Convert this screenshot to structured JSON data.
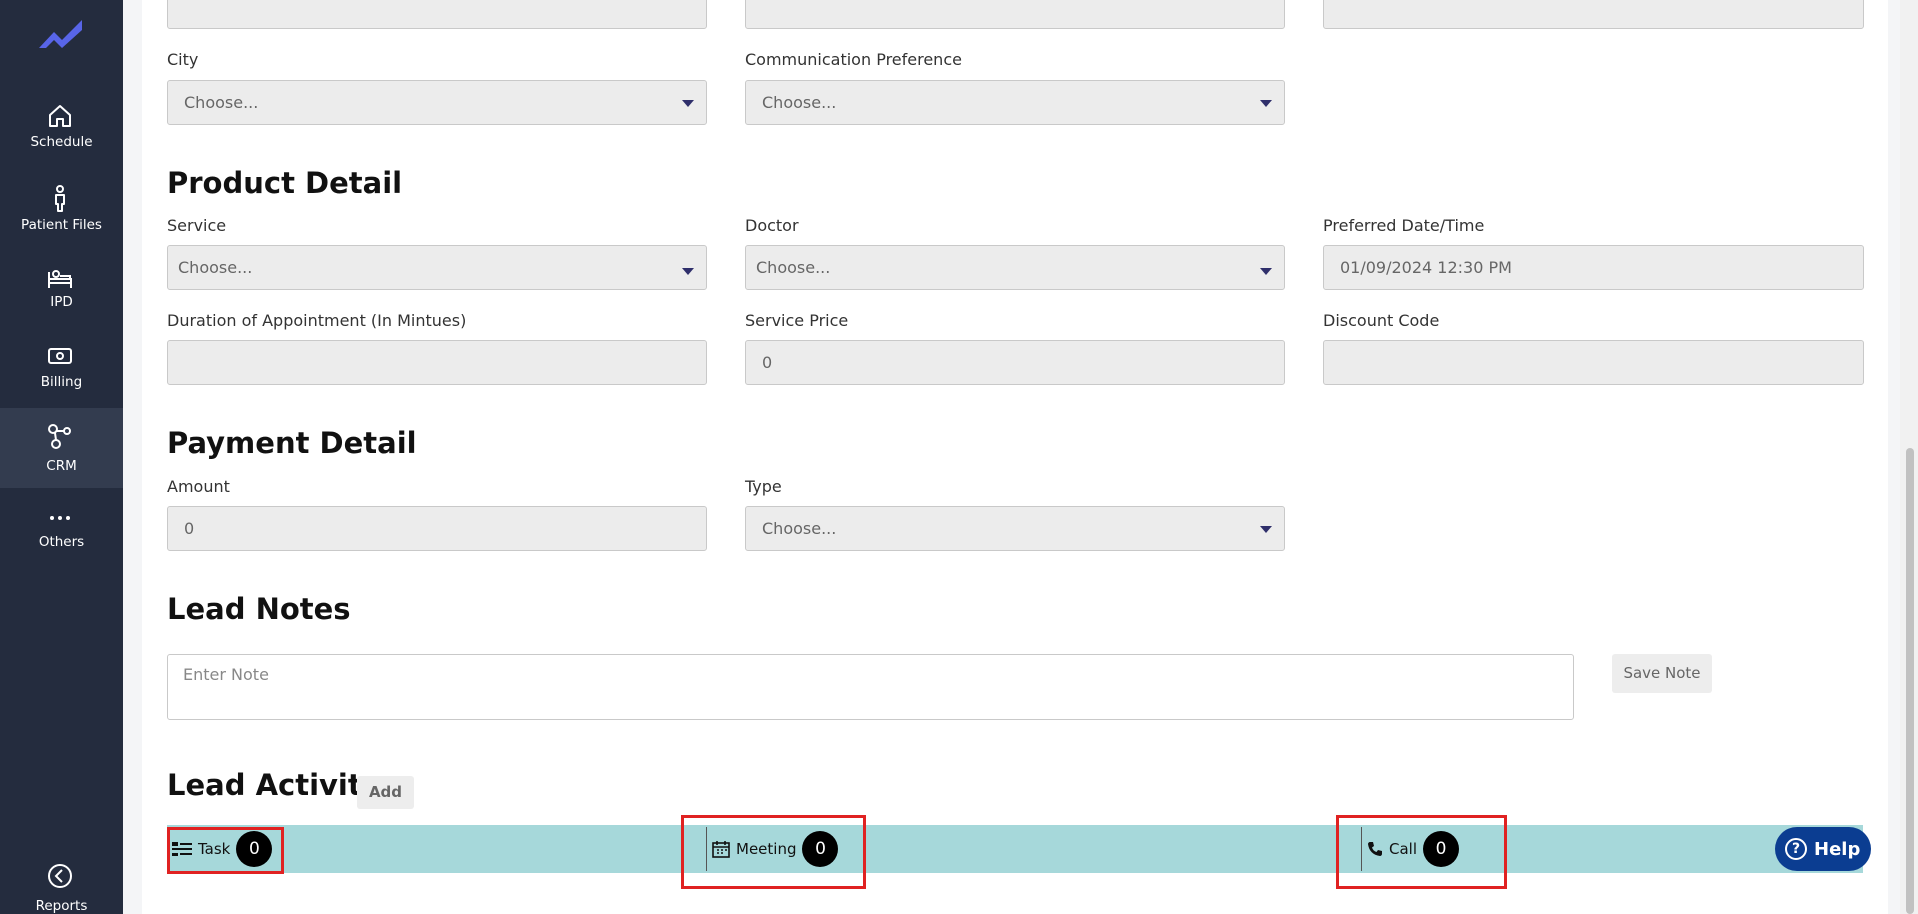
{
  "sidebar": {
    "items": [
      {
        "label": "Schedule",
        "icon": "home-icon"
      },
      {
        "label": "Patient Files",
        "icon": "person-icon"
      },
      {
        "label": "IPD",
        "icon": "bed-icon"
      },
      {
        "label": "Billing",
        "icon": "money-icon"
      },
      {
        "label": "CRM",
        "icon": "crm-icon"
      },
      {
        "label": "Others",
        "icon": "dots-icon"
      },
      {
        "label": "Reports",
        "icon": "reports-icon"
      }
    ],
    "active": "CRM"
  },
  "contact": {
    "city_label": "City",
    "city_value": "Choose...",
    "comm_label": "Communication Preference",
    "comm_value": "Choose..."
  },
  "product": {
    "title": "Product Detail",
    "service_label": "Service",
    "service_value": "Choose...",
    "doctor_label": "Doctor",
    "doctor_value": "Choose...",
    "date_label": "Preferred Date/Time",
    "date_value": "01/09/2024 12:30 PM",
    "duration_label": "Duration of Appointment (In Mintues)",
    "duration_value": "",
    "price_label": "Service Price",
    "price_value": "0",
    "discount_label": "Discount Code",
    "discount_value": ""
  },
  "payment": {
    "title": "Payment Detail",
    "amount_label": "Amount",
    "amount_value": "0",
    "type_label": "Type",
    "type_value": "Choose..."
  },
  "notes": {
    "title": "Lead Notes",
    "placeholder": "Enter Note",
    "save_label": "Save Note"
  },
  "activity": {
    "title": "Lead Activity",
    "add_label": "Add",
    "task_label": "Task",
    "task_count": "0",
    "meeting_label": "Meeting",
    "meeting_count": "0",
    "call_label": "Call",
    "call_count": "0"
  },
  "help": {
    "label": "Help",
    "glyph": "?"
  },
  "colors": {
    "sidebar": "#242c3e",
    "activity_bar": "#a6d8da",
    "highlight": "#e02222",
    "help": "#0b3d91"
  }
}
